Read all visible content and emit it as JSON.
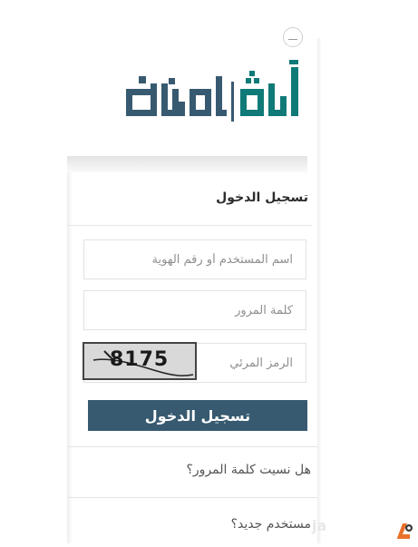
{
  "header": {
    "logo_text": "أبشر | توظيف"
  },
  "login_panel": {
    "title": "تسجيل الدخول",
    "username_placeholder": "اسم المستخدم أو رقم الهوية",
    "password_placeholder": "كلمة المرور",
    "captcha_placeholder": "الرمز المرئي",
    "captcha_code": "8175",
    "login_button": "تسجيل الدخول"
  },
  "links": {
    "forgot_password": "هل نسيت كلمة المرور؟",
    "new_user": "مستخدم جديد؟"
  },
  "watermark": {
    "text": "ja"
  },
  "colors": {
    "brand": "#375a70",
    "logo_accent": "#0f7a78",
    "background": "#ffffff"
  }
}
